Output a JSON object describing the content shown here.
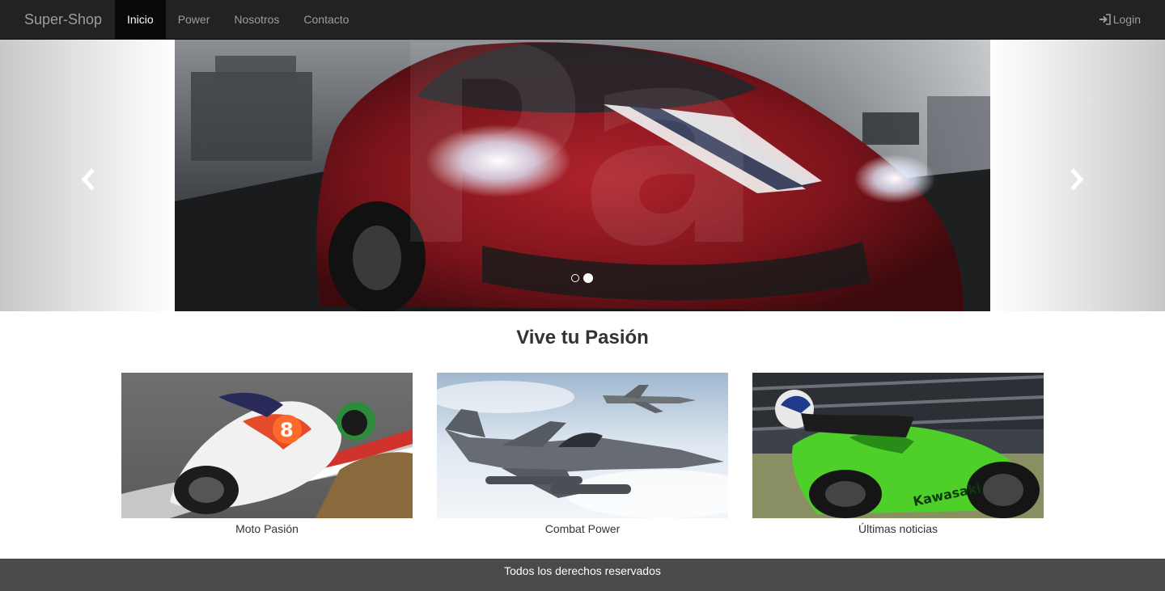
{
  "navbar": {
    "brand": "Super-Shop",
    "items": [
      {
        "label": "Inicio",
        "active": true
      },
      {
        "label": "Power",
        "active": false
      },
      {
        "label": "Nosotros",
        "active": false
      },
      {
        "label": "Contacto",
        "active": false
      }
    ],
    "login_label": "Login",
    "login_icon": "login-icon",
    "background_color": "#222222",
    "active_color": "#080808"
  },
  "carousel": {
    "slide_count": 2,
    "active_index": 1,
    "prev_icon": "chevron-left-icon",
    "next_icon": "chevron-right-icon"
  },
  "section": {
    "title": "Vive tu Pasión"
  },
  "cards": [
    {
      "caption": "Moto Pasión"
    },
    {
      "caption": "Combat Power"
    },
    {
      "caption": "Últimas noticias"
    }
  ],
  "footer": {
    "text": "Todos los derechos reservados",
    "background_color": "#4a4a4a"
  }
}
